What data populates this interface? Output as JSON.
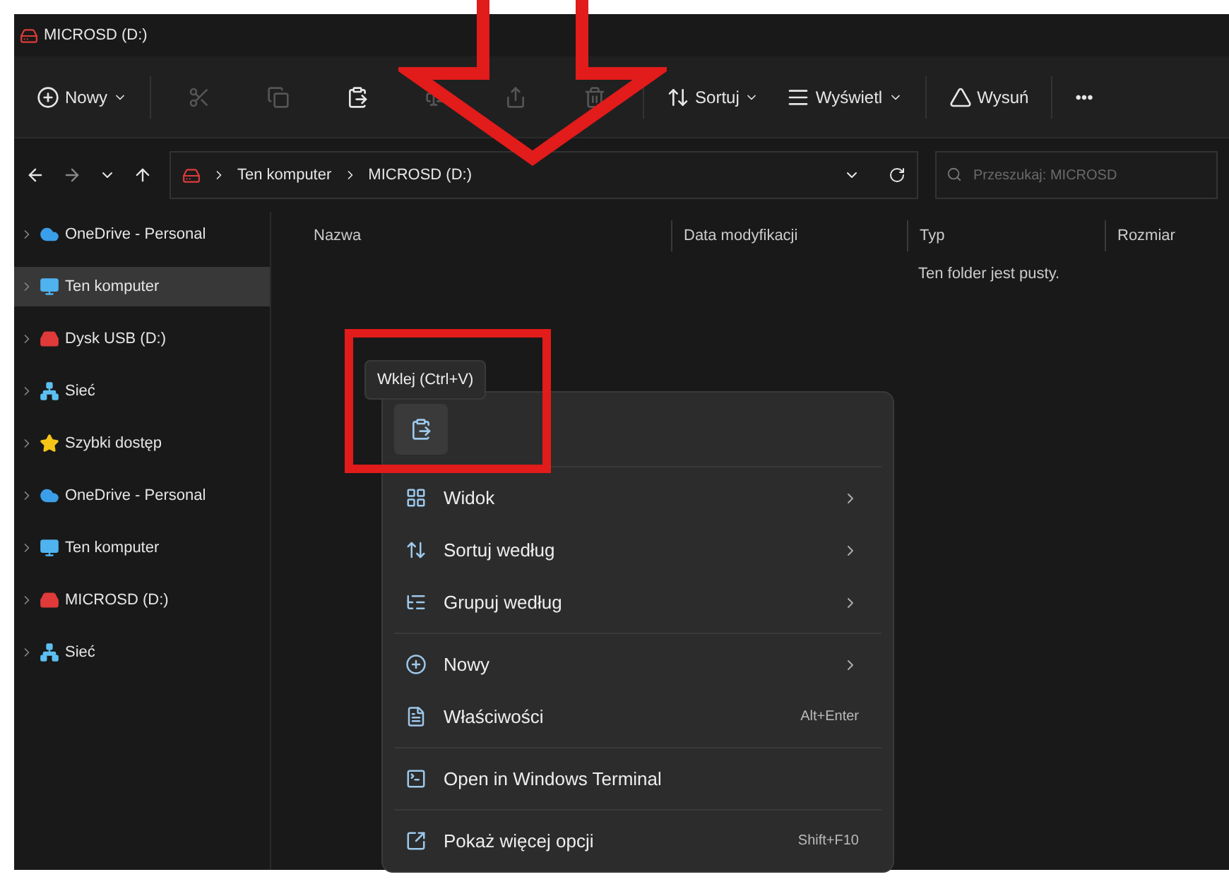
{
  "window": {
    "title": "MICROSD (D:)"
  },
  "toolbar": {
    "items": [
      {
        "kind": "new",
        "label": "Nowy",
        "dropdown": true,
        "disabled": false
      },
      {
        "kind": "cut",
        "disabled": true
      },
      {
        "kind": "copy",
        "disabled": true
      },
      {
        "kind": "paste",
        "disabled": false
      },
      {
        "kind": "rename",
        "disabled": true
      },
      {
        "kind": "share",
        "disabled": true
      },
      {
        "kind": "delete",
        "disabled": true
      },
      {
        "kind": "sort",
        "label": "Sortuj",
        "dropdown": true,
        "disabled": false
      },
      {
        "kind": "view",
        "label": "Wyświetl",
        "dropdown": true,
        "disabled": false
      },
      {
        "kind": "eject",
        "label": "Wysuń",
        "dropdown": false,
        "disabled": false
      },
      {
        "kind": "more",
        "label": "•••",
        "dropdown": false,
        "disabled": false
      }
    ]
  },
  "address_bar": {
    "crumbs": [
      "Ten komputer",
      "MICROSD (D:)"
    ]
  },
  "search": {
    "placeholder": "Przeszukaj: MICROSD"
  },
  "sidebar": {
    "items": [
      {
        "kind": "cloud",
        "label": "OneDrive - Personal",
        "selected": false
      },
      {
        "kind": "pc",
        "label": "Ten komputer",
        "selected": true
      },
      {
        "kind": "drive",
        "label": "Dysk USB (D:)",
        "selected": false
      },
      {
        "kind": "network",
        "label": "Sieć",
        "selected": false
      },
      {
        "kind": "star",
        "label": "Szybki dostęp",
        "selected": false
      },
      {
        "kind": "cloud",
        "label": "OneDrive - Personal",
        "selected": false
      },
      {
        "kind": "pc",
        "label": "Ten komputer",
        "selected": false
      },
      {
        "kind": "drive",
        "label": "MICROSD (D:)",
        "selected": false
      },
      {
        "kind": "network",
        "label": "Sieć",
        "selected": false
      }
    ]
  },
  "table": {
    "columns": [
      "Nazwa",
      "Data modyfikacji",
      "Typ",
      "Rozmiar"
    ],
    "empty_message": "Ten folder jest pusty."
  },
  "context_menu": {
    "tooltip": "Wklej (Ctrl+V)",
    "groups": [
      [
        {
          "kind": "view",
          "label": "Widok",
          "submenu": true
        },
        {
          "kind": "sort",
          "label": "Sortuj według",
          "submenu": true
        },
        {
          "kind": "group",
          "label": "Grupuj według",
          "submenu": true
        }
      ],
      [
        {
          "kind": "new",
          "label": "Nowy",
          "submenu": true
        },
        {
          "kind": "properties",
          "label": "Właściwości",
          "shortcut": "Alt+Enter",
          "submenu": false
        }
      ],
      [
        {
          "kind": "terminal",
          "label": "Open in Windows Terminal",
          "submenu": false
        }
      ],
      [
        {
          "kind": "more",
          "label": "Pokaż więcej opcji",
          "shortcut": "Shift+F10",
          "submenu": false
        }
      ]
    ]
  }
}
